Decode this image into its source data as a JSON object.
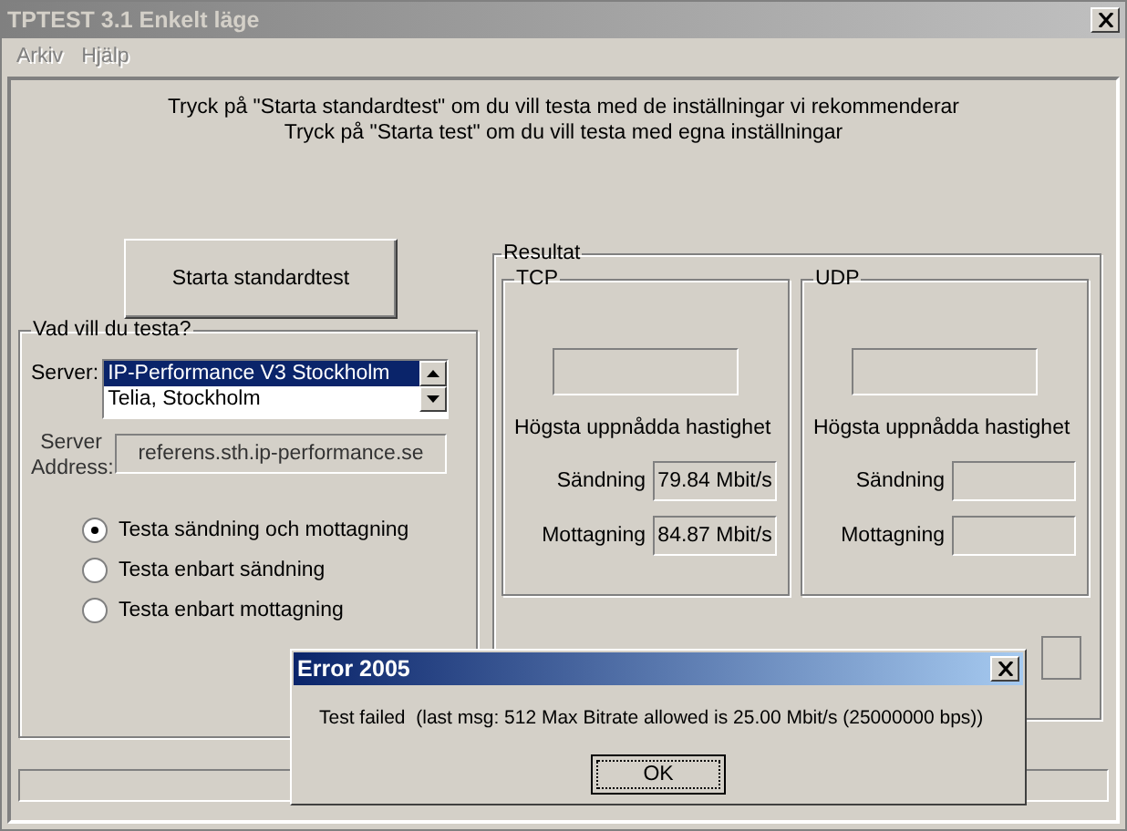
{
  "window": {
    "title": "TPTEST 3.1 Enkelt läge",
    "active": false
  },
  "menu": [
    {
      "label": "Arkiv",
      "disabled": true
    },
    {
      "label": "Hjälp",
      "disabled": true
    }
  ],
  "instructions": [
    "Tryck på \"Starta standardtest\" om du vill testa med de inställningar vi rekommenderar",
    "Tryck på \"Starta test\" om du vill testa med egna inställningar"
  ],
  "standard_button": "Starta standardtest",
  "test_group": {
    "title": "Vad vill du testa?",
    "server_label": "Server:",
    "servers": [
      {
        "name": "IP-Performance V3 Stockholm",
        "selected": true
      },
      {
        "name": "Telia, Stockholm",
        "selected": false
      }
    ],
    "address_label": "Server Address:",
    "address": "referens.sth.ip-performance.se",
    "options": [
      {
        "label": "Testa sändning och mottagning",
        "selected": true
      },
      {
        "label": "Testa enbart sändning",
        "selected": false
      },
      {
        "label": "Testa enbart mottagning",
        "selected": false
      }
    ]
  },
  "results": {
    "title": "Resultat",
    "protocols": [
      {
        "title": "TCP",
        "speed_label": "Högsta uppnådda hastighet",
        "send_label": "Sändning",
        "send": "79.84 Mbit/s",
        "receive_label": "Mottagning",
        "receive": "84.87 Mbit/s"
      },
      {
        "title": "UDP",
        "speed_label": "Högsta uppnådda hastighet",
        "send_label": "Sändning",
        "receive_label": "Mottagning"
      }
    ]
  },
  "progress": {
    "level": 0
  },
  "dialog": {
    "title": "Error 2005",
    "message": "Test failed  (last msg: 512 Max Bitrate allowed is 25.00 Mbit/s (25000000 bps))",
    "button": "OK"
  }
}
